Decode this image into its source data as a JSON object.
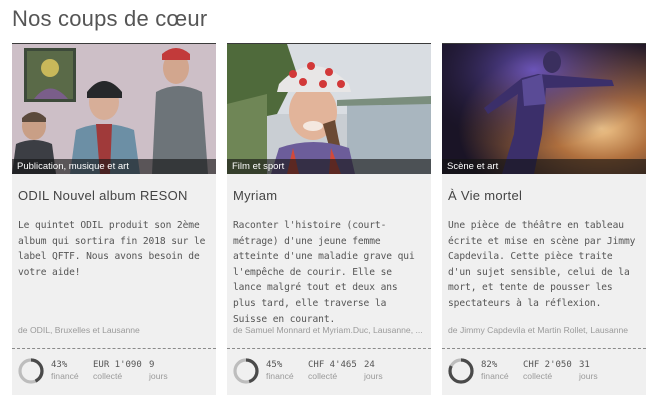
{
  "section": {
    "title": "Nos coups de cœur"
  },
  "colors": {
    "ring_track": "#bdbdbd",
    "ring_fill": "#4a4a4a"
  },
  "cards": [
    {
      "category": "Publication, musique et art",
      "title": "ODIL Nouvel album RESON",
      "description": "Le quintet ODIL produit son 2ème album qui sortira fin 2018 sur le label QFTF. Nous avons besoin de votre aide!",
      "author": "de ODIL, Bruxelles et Lausanne",
      "funded": {
        "value": "43%",
        "label": "financé",
        "fraction": 0.43
      },
      "collected": {
        "value": "EUR 1'090",
        "label": "collecté"
      },
      "days": {
        "value": "9",
        "label": "jours"
      }
    },
    {
      "category": "Film et sport",
      "title": "Myriam",
      "description": "Raconter l'histoire (court-métrage) d'une jeune femme atteinte d'une maladie grave qui l'empêche de courir. Elle se lance malgré tout et deux ans plus tard, elle traverse la Suisse en courant.",
      "author": "de Samuel Monnard et Myriam.Duc, Lausanne, ...",
      "funded": {
        "value": "45%",
        "label": "financé",
        "fraction": 0.45
      },
      "collected": {
        "value": "CHF 4'465",
        "label": "collecté"
      },
      "days": {
        "value": "24",
        "label": "jours"
      }
    },
    {
      "category": "Scène et art",
      "title": "À Vie mortel",
      "description": "Une pièce de théâtre en tableau écrite et mise en scène par Jimmy Capdevila. Cette pièce traite d'un sujet sensible, celui de la mort, et tente de pousser les spectateurs à la réflexion.",
      "author": "de Jimmy Capdevila et Martin Rollet, Lausanne",
      "funded": {
        "value": "82%",
        "label": "financé",
        "fraction": 0.82
      },
      "collected": {
        "value": "CHF 2'050",
        "label": "collecté"
      },
      "days": {
        "value": "31",
        "label": "jours"
      }
    }
  ]
}
